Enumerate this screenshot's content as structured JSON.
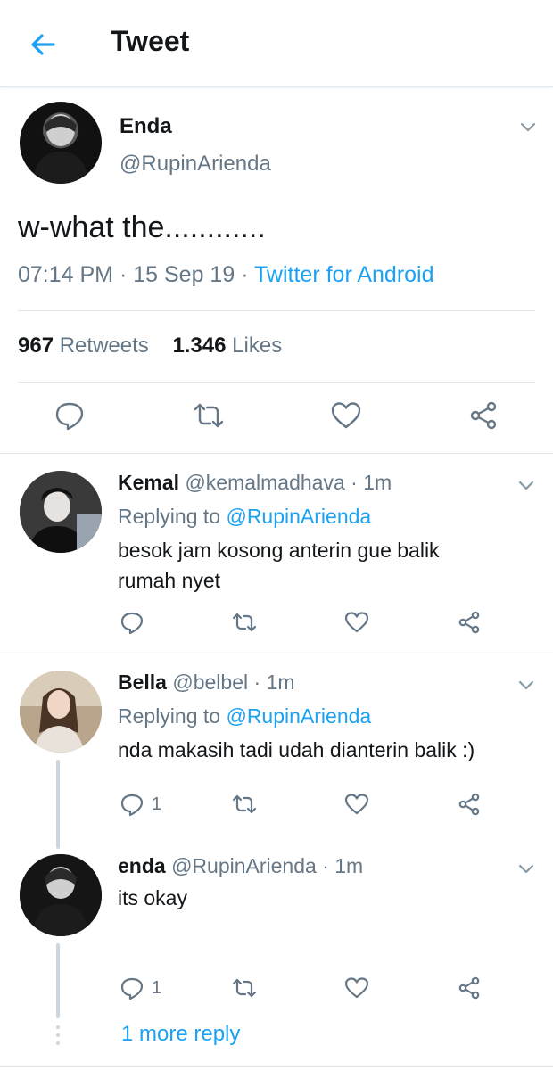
{
  "header": {
    "title": "Tweet",
    "back_icon": "arrow-left-icon"
  },
  "main_tweet": {
    "name": "Enda",
    "handle": "@RupinArienda",
    "text": "w-what the............",
    "time": "07:14 PM",
    "date": "15 Sep 19",
    "source": "Twitter for Android",
    "retweets_count": "967",
    "retweets_label": "Retweets",
    "likes_count": "1.346",
    "likes_label": "Likes"
  },
  "replies": [
    {
      "name": "Kemal",
      "handle": "@kemalmadhava",
      "time": "1m",
      "replying_prefix": "Replying to",
      "replying_to": "@RupinArienda",
      "text_line1": "besok jam kosong anterin gue balik",
      "text_line2": "rumah nyet",
      "reply_count": ""
    },
    {
      "name": "Bella",
      "handle": "@belbel",
      "time": "1m",
      "replying_prefix": "Replying to",
      "replying_to": "@RupinArienda",
      "text_line1": "nda makasih tadi udah dianterin balik :)",
      "reply_count": "1"
    },
    {
      "name": "enda",
      "handle": "@RupinArienda",
      "time": "1m",
      "text_line1": "its okay",
      "reply_count": "1"
    }
  ],
  "more_replies": "1 more reply",
  "colors": {
    "accent": "#1da1f2",
    "muted": "#657786",
    "text": "#14171a",
    "divider": "#e1e8ed"
  }
}
